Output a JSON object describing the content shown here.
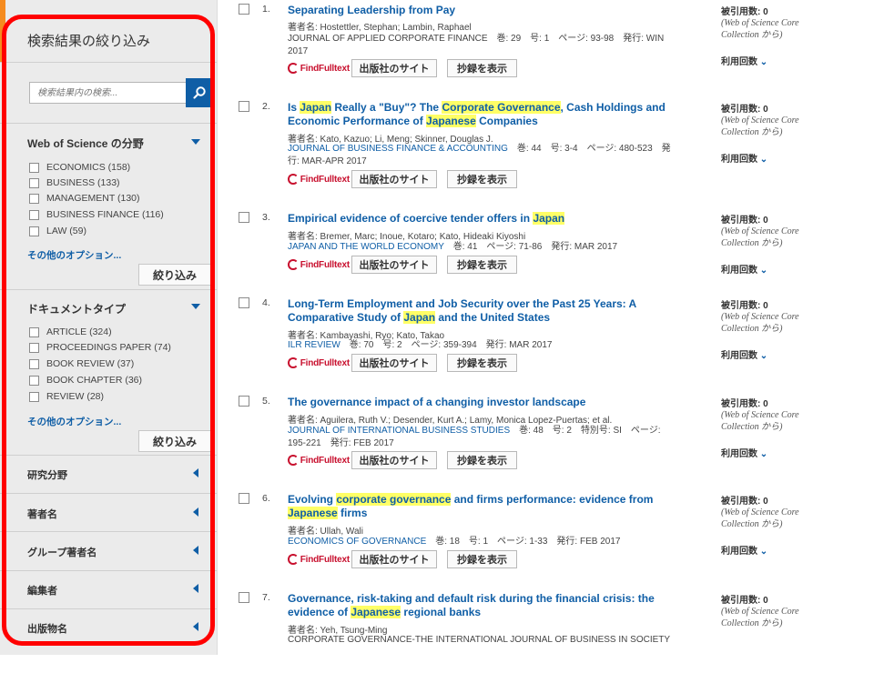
{
  "sidebar": {
    "title": "検索結果の絞り込み",
    "search_placeholder": "検索結果内の検索...",
    "wos_category": {
      "title": "Web of Science の分野",
      "items": [
        {
          "label": "ECONOMICS (158)"
        },
        {
          "label": "BUSINESS (133)"
        },
        {
          "label": "MANAGEMENT (130)"
        },
        {
          "label": "BUSINESS FINANCE (116)"
        },
        {
          "label": "LAW (59)"
        }
      ],
      "more": "その他のオプション...",
      "refine": "絞り込み"
    },
    "doc_type": {
      "title": "ドキュメントタイプ",
      "items": [
        {
          "label": "ARTICLE (324)"
        },
        {
          "label": "PROCEEDINGS PAPER (74)"
        },
        {
          "label": "BOOK REVIEW (37)"
        },
        {
          "label": "BOOK CHAPTER (36)"
        },
        {
          "label": "REVIEW (28)"
        }
      ],
      "more": "その他のオプション...",
      "refine": "絞り込み"
    },
    "accordions": [
      {
        "label": "研究分野"
      },
      {
        "label": "著者名"
      },
      {
        "label": "グループ著者名"
      },
      {
        "label": "編集者"
      },
      {
        "label": "出版物名"
      }
    ]
  },
  "labels": {
    "findfulltext": "FindFulltext",
    "publisher_site": "出版社のサイト",
    "show_abstract": "抄録を表示",
    "times_cited": "被引用数",
    "wos_core_line1": "(Web of Science Core",
    "wos_core_line2": "Collection から)",
    "usage": "利用回数"
  },
  "results": [
    {
      "num": "1.",
      "title_segments": [
        {
          "t": "Separating Leadership from Pay",
          "h": false
        }
      ],
      "authors": "著者名: Hostettler, Stephan; Lambin, Raphael",
      "journal": "JOURNAL OF APPLIED CORPORATE FINANCE",
      "details_line1": "巻: 29　号: 1　ページ: 93-98　発行: WIN",
      "details_line2": "2017",
      "journal_linked": false,
      "cites": "0"
    },
    {
      "num": "2.",
      "title_segments": [
        {
          "t": "Is ",
          "h": false
        },
        {
          "t": "Japan",
          "h": true
        },
        {
          "t": " Really a \"Buy\"? The ",
          "h": false
        },
        {
          "t": "Corporate Governance",
          "h": true
        },
        {
          "t": ", Cash Holdings and Economic Performance of ",
          "h": false
        },
        {
          "t": "Japanese",
          "h": true
        },
        {
          "t": " Companies",
          "h": false
        }
      ],
      "authors": "著者名: Kato, Kazuo; Li, Meng; Skinner, Douglas J.",
      "journal": "JOURNAL OF BUSINESS FINANCE & ACCOUNTING",
      "details_line1": "巻: 44　号: 3-4　ページ: 480-523　発",
      "details_line2": "行: MAR-APR 2017",
      "journal_linked": true,
      "cites": "0"
    },
    {
      "num": "3.",
      "title_segments": [
        {
          "t": "Empirical evidence of coercive tender offers in ",
          "h": false
        },
        {
          "t": "Japan",
          "h": true
        }
      ],
      "authors": "著者名: Bremer, Marc; Inoue, Kotaro; Kato, Hideaki Kiyoshi",
      "journal": "JAPAN AND THE WORLD ECONOMY",
      "details_line1": "巻: 41　ページ: 71-86　発行: MAR 2017",
      "details_line2": "",
      "journal_linked": true,
      "cites": "0"
    },
    {
      "num": "4.",
      "title_segments": [
        {
          "t": "Long-Term Employment and Job Security over the Past 25 Years: A Comparative Study of ",
          "h": false
        },
        {
          "t": "Japan",
          "h": true
        },
        {
          "t": " and the United States",
          "h": false
        }
      ],
      "authors": "著者名: Kambayashi, Ryo; Kato, Takao",
      "journal": "ILR REVIEW",
      "details_line1": "巻: 70　号: 2　ページ: 359-394　発行: MAR 2017",
      "details_line2": "",
      "journal_linked": true,
      "cites": "0"
    },
    {
      "num": "5.",
      "title_segments": [
        {
          "t": "The governance impact of a changing investor landscape",
          "h": false
        }
      ],
      "authors": "著者名: Aguilera, Ruth V.; Desender, Kurt A.; Lamy, Monica Lopez-Puertas; et al.",
      "journal": "JOURNAL OF INTERNATIONAL BUSINESS STUDIES",
      "details_line1": "巻: 48　号: 2　特別号: SI　ページ:",
      "details_line2": "195-221　発行: FEB 2017",
      "journal_linked": true,
      "cites": "0"
    },
    {
      "num": "6.",
      "title_segments": [
        {
          "t": "Evolving ",
          "h": false
        },
        {
          "t": "corporate governance",
          "h": true
        },
        {
          "t": " and firms performance: evidence from ",
          "h": false
        },
        {
          "t": "Japanese",
          "h": true
        },
        {
          "t": " firms",
          "h": false
        }
      ],
      "authors": "著者名: Ullah, Wali",
      "journal": "ECONOMICS OF GOVERNANCE",
      "details_line1": "巻: 18　号: 1　ページ: 1-33　発行: FEB 2017",
      "details_line2": "",
      "journal_linked": true,
      "cites": "0"
    },
    {
      "num": "7.",
      "title_segments": [
        {
          "t": "Governance, risk-taking and default risk during the financial crisis: the evidence of ",
          "h": false
        },
        {
          "t": "Japanese",
          "h": true
        },
        {
          "t": " regional banks",
          "h": false
        }
      ],
      "authors": "著者名: Yeh, Tsung-Ming",
      "journal": "CORPORATE GOVERNANCE-THE INTERNATIONAL JOURNAL OF BUSINESS IN SOCIETY",
      "details_line1": "",
      "details_line2": "",
      "journal_linked": false,
      "cites": "0"
    }
  ],
  "colors": {
    "link": "#0f5ea6",
    "highlight": "#ffff66",
    "frame": "#ff0000",
    "accent": "#f58b1f",
    "findfulltext": "#c8102e"
  }
}
